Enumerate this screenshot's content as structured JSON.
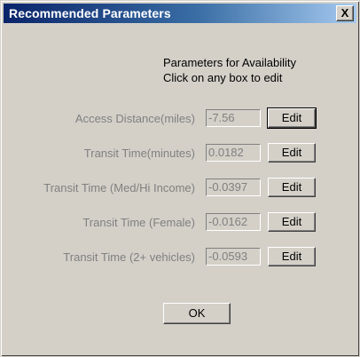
{
  "window": {
    "title": "Recommended Parameters",
    "close_label": "X"
  },
  "instructions": {
    "line1": "Parameters for Availability",
    "line2": "Click on any box to edit"
  },
  "parameters": [
    {
      "label": "Access Distance(miles)",
      "value": "-7.56",
      "edit_label": "Edit"
    },
    {
      "label": "Transit Time(minutes)",
      "value": "0.0182",
      "edit_label": "Edit"
    },
    {
      "label": "Transit Time (Med/Hi Income)",
      "value": "-0.0397",
      "edit_label": "Edit"
    },
    {
      "label": "Transit Time (Female)",
      "value": "-0.0162",
      "edit_label": "Edit"
    },
    {
      "label": "Transit Time (2+ vehicles)",
      "value": "-0.0593",
      "edit_label": "Edit"
    }
  ],
  "ok_label": "OK"
}
